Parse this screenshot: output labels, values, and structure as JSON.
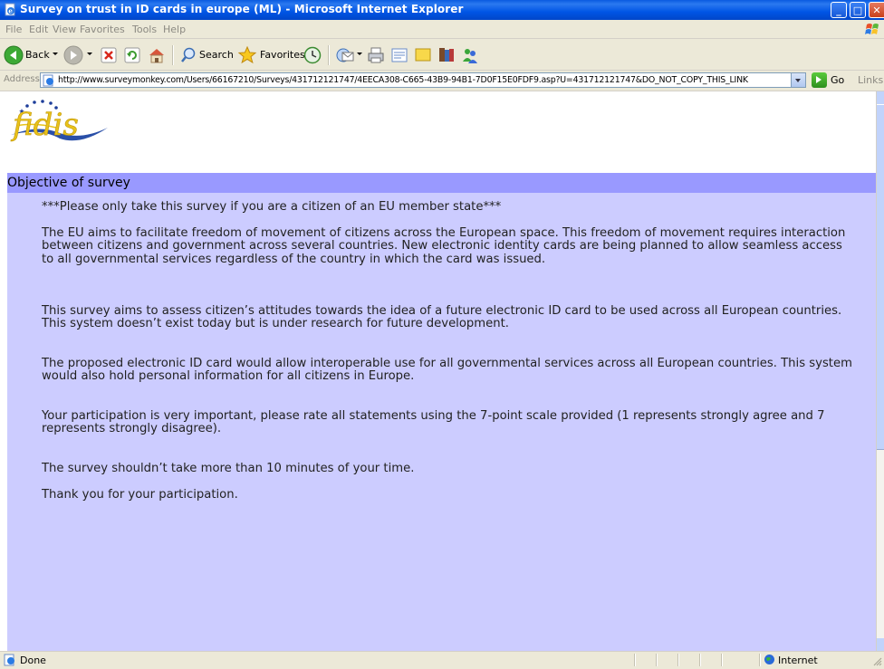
{
  "window": {
    "title": "Survey on trust in ID cards in europe (ML) - Microsoft Internet Explorer",
    "min_label": "_",
    "max_label": "□",
    "close_label": "✕"
  },
  "menu": {
    "items": [
      "File",
      "Edit",
      "View",
      "Favorites",
      "Tools",
      "Help"
    ]
  },
  "toolbar": {
    "back_label": "Back",
    "search_label": "Search",
    "favorites_label": "Favorites"
  },
  "address": {
    "label": "Address",
    "url": "http://www.surveymonkey.com/Users/66167210/Surveys/431712121747/4EECA308-C665-43B9-94B1-7D0F15E0FDF9.asp?U=431712121747&DO_NOT_COPY_THIS_LINK",
    "go_label": "Go",
    "links_label": "Links"
  },
  "page": {
    "logo_text": "fidis",
    "section_title": "Objective of survey",
    "paragraphs": [
      "***Please only take this survey if you are a citizen of an EU member state***",
      "The EU aims to facilitate freedom of movement of citizens across the European space. This freedom of movement requires interaction between citizens and government across several countries. New electronic identity cards are being planned to allow seamless access to all governmental services regardless of the country in which the card was issued.",
      "This survey aims to assess citizen’s attitudes towards the idea of a future electronic ID card to be used across all European countries. This system doesn’t exist today but is under research for future development.",
      "The proposed electronic ID card would allow interoperable use for all governmental services across all European countries. This system would also hold personal information for all citizens in Europe.",
      "Your participation is very important, please rate all statements using the 7-point scale provided (1 represents strongly agree and 7 represents strongly disagree).",
      "The survey shouldn’t take more than 10 minutes of your time.",
      "Thank you for your participation."
    ]
  },
  "status": {
    "text": "Done",
    "zone": "Internet"
  },
  "colors": {
    "section_header": "#9999FF",
    "body_background": "#CCCCFF",
    "titlebar": "#0055E5"
  }
}
